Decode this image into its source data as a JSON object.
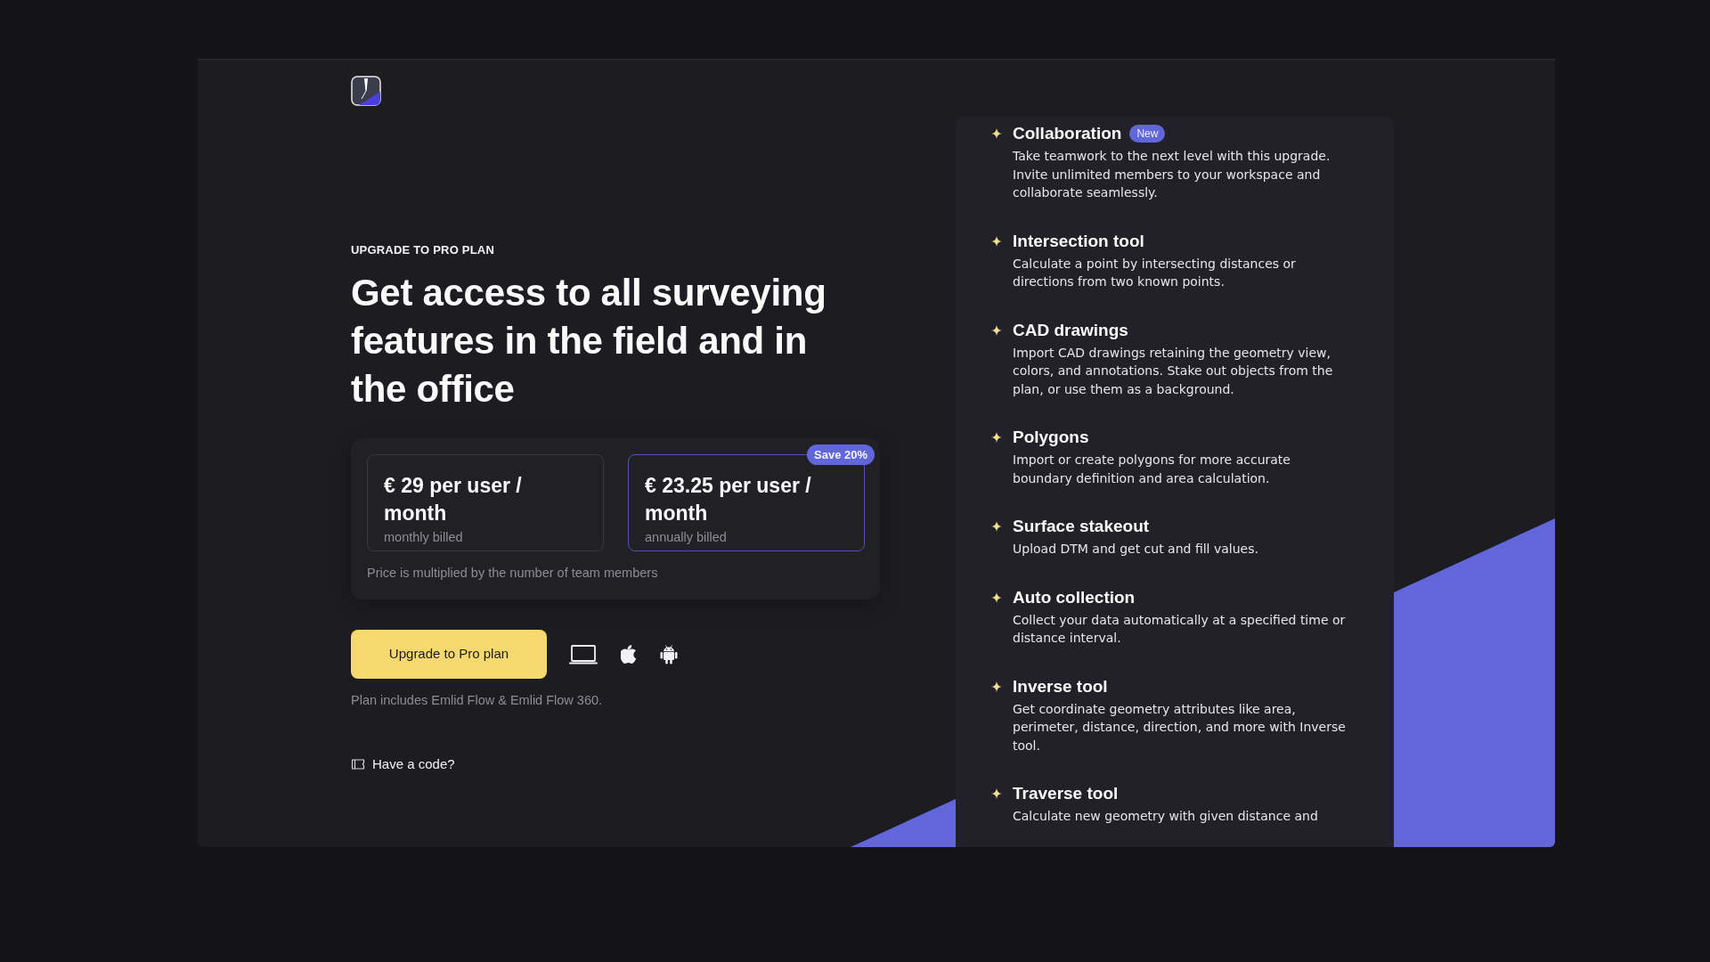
{
  "eyebrow": "UPGRADE TO PRO PLAN",
  "heading": "Get access to all surveying features in the field and in the office",
  "plans": [
    {
      "price": "€ 29 per user / month",
      "billing": "monthly billed",
      "selected": false
    },
    {
      "price": "€ 23.25 per user / month",
      "billing": "annually billed",
      "selected": true,
      "badge": "Save 20%"
    }
  ],
  "price_note": "Price is multiplied by the number of team members",
  "upgrade_button": "Upgrade to Pro plan",
  "platforms": [
    {
      "kind": "laptop"
    },
    {
      "kind": "apple"
    },
    {
      "kind": "android"
    }
  ],
  "plan_includes": "Plan includes Emlid Flow & Emlid Flow 360.",
  "code_link": "Have a code?",
  "features": [
    {
      "title": "Collaboration",
      "badge": "New",
      "description": "Take teamwork to the next level with this upgrade. Invite unlimited members to your workspace and collaborate seamlessly."
    },
    {
      "title": "Intersection tool",
      "description": "Calculate a point by intersecting distances or directions from two known points."
    },
    {
      "title": "CAD drawings",
      "description": "Import CAD drawings retaining the geometry view, colors, and annotations. Stake out objects from the plan, or use them as a background."
    },
    {
      "title": "Polygons",
      "description": "Import or create polygons for more accurate boundary definition and area calculation."
    },
    {
      "title": "Surface stakeout",
      "description": "Upload DTM and get cut and fill values."
    },
    {
      "title": "Auto collection",
      "description": "Collect your data automatically at a specified time or distance interval."
    },
    {
      "title": "Inverse tool",
      "description": "Get coordinate geometry attributes like area, perimeter, distance, direction, and more with Inverse tool."
    },
    {
      "title": "Traverse tool",
      "description": "Calculate new geometry with given distance and"
    }
  ]
}
